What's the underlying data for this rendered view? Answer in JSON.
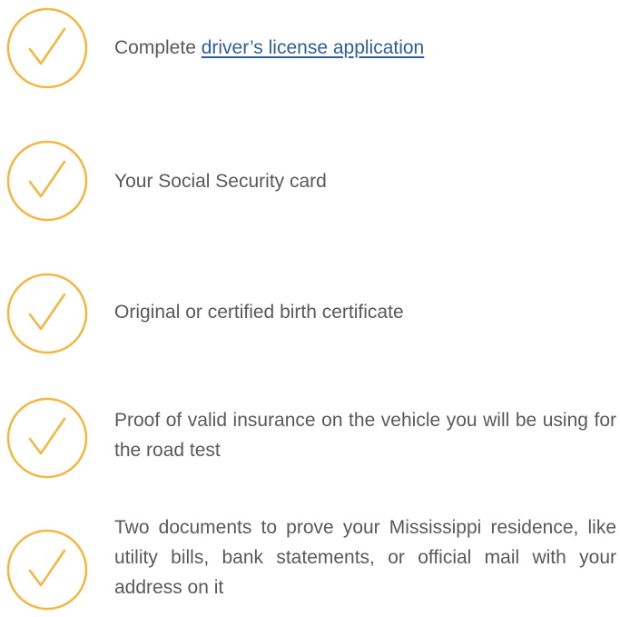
{
  "accent_color": "#f4b63f",
  "link_color": "#2f5e9c",
  "items": [
    {
      "icon": "check-circle-icon",
      "prefix": "Complete ",
      "link": "driver’s license application"
    },
    {
      "icon": "check-circle-icon",
      "text": "Your Social Security card"
    },
    {
      "icon": "check-circle-icon",
      "text": "Original or certified birth certificate"
    },
    {
      "icon": "check-circle-icon",
      "text": "Proof of valid insurance on the vehicle you will be using for the road test"
    },
    {
      "icon": "check-circle-icon",
      "text": "Two documents to prove your Mississippi residence, like utility bills, bank statements, or official mail with your address on it"
    }
  ]
}
